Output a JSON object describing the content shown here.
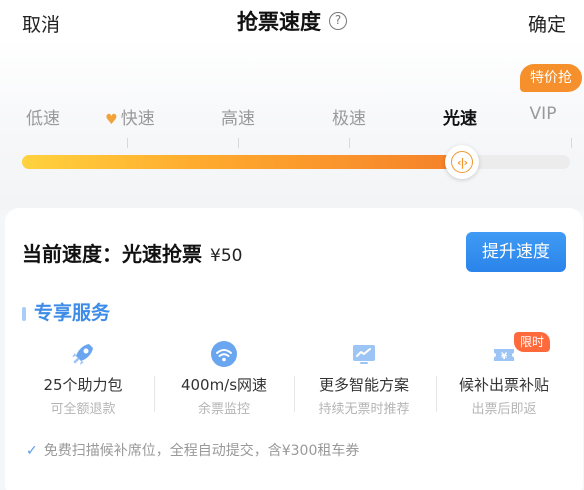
{
  "header": {
    "cancel_label": "取消",
    "title": "抢票速度",
    "help_icon": "question-circle-icon",
    "confirm_label": "确定"
  },
  "speed_selector": {
    "badge": "特价抢",
    "levels": [
      {
        "label": "低速",
        "icon": null
      },
      {
        "label": "快速",
        "icon": "heart-icon"
      },
      {
        "label": "高速",
        "icon": null
      },
      {
        "label": "极速",
        "icon": null
      },
      {
        "label": "光速",
        "icon": null,
        "selected": true
      },
      {
        "label": "VIP",
        "icon": null
      }
    ],
    "selected_index": 4,
    "slider_fill_fraction": 0.8,
    "colors": {
      "fill_start": "#ffd23e",
      "fill_end": "#f5812a",
      "track": "#ececec"
    }
  },
  "current": {
    "label": "当前速度：光速抢票",
    "price": "¥50",
    "upgrade_label": "提升速度",
    "accent": "#2a84ea"
  },
  "services": {
    "title": "专享服务",
    "items": [
      {
        "icon": "rocket-icon",
        "title": "25个助力包",
        "sub": "可全额退款"
      },
      {
        "icon": "wifi-icon",
        "title": "400m/s网速",
        "sub": "余票监控"
      },
      {
        "icon": "chart-monitor-icon",
        "title": "更多智能方案",
        "sub": "持续无票时推荐"
      },
      {
        "icon": "ticket-icon",
        "title": "候补出票补贴",
        "sub": "出票后即返",
        "badge": "限时"
      }
    ],
    "footnote": "免费扫描候补席位，全程自动提交，含¥300租车券"
  }
}
